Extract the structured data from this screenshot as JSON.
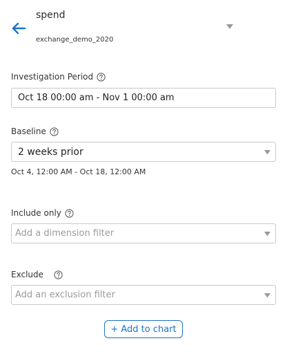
{
  "colors": {
    "accent": "#1a73c9",
    "text": "#333333",
    "placeholder": "#9b9b9b",
    "border": "#c9c9c9"
  },
  "header": {
    "back_icon": "arrow-left-icon",
    "metric_name": "spend",
    "dataset_name": "exchange_demo_2020",
    "caret_icon": "caret-down-icon"
  },
  "investigation_period": {
    "label": "Investigation Period",
    "help_icon": "question-circle-icon",
    "value": "Oct 18 00:00 am - Nov 1 00:00 am"
  },
  "baseline": {
    "label": "Baseline",
    "help_icon": "question-circle-icon",
    "selected": "2 weeks prior",
    "range_text": "Oct 4, 12:00 AM - Oct 18, 12:00 AM"
  },
  "include_only": {
    "label": "Include only",
    "help_icon": "question-circle-icon",
    "placeholder": "Add a dimension filter"
  },
  "exclude": {
    "label": "Exclude",
    "help_icon": "question-circle-icon",
    "placeholder": "Add an exclusion filter"
  },
  "add_to_chart": {
    "label": "+ Add to chart"
  }
}
